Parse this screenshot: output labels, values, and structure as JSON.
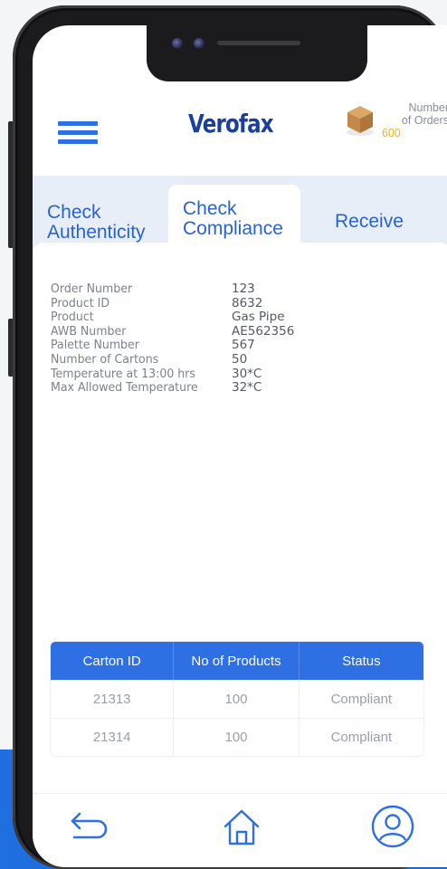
{
  "colors": {
    "accent": "#2f6fe4",
    "order_count": "#e9b42a",
    "brand": "#1d3a8a"
  },
  "header": {
    "logo_text": "Verofax",
    "menu_icon": "hamburger-icon",
    "orders_label_1": "Number",
    "orders_label_2": "of Orders",
    "orders_count": "600"
  },
  "tabs": [
    {
      "line1": "Check",
      "line2": "Authenticity",
      "active": false
    },
    {
      "line1": "Check",
      "line2": "Compliance",
      "active": true
    },
    {
      "line1": "Receive",
      "line2": "",
      "active": false
    }
  ],
  "details": [
    {
      "label": "Order Number",
      "value": "123"
    },
    {
      "label": "Product ID",
      "value": "8632"
    },
    {
      "label": "Product",
      "value": "Gas Pipe"
    },
    {
      "label": "AWB Number",
      "value": "AE562356"
    },
    {
      "label": "Palette Number",
      "value": "567"
    },
    {
      "label": "Number of Cartons",
      "value": "50"
    },
    {
      "label": "Temperature at 13:00 hrs",
      "value": "30*C"
    },
    {
      "label": "Max Allowed Temperature",
      "value": "32*C"
    }
  ],
  "table": {
    "headers": [
      "Carton ID",
      "No of Products",
      "Status"
    ],
    "rows": [
      [
        "21313",
        "100",
        "Compliant"
      ],
      [
        "21314",
        "100",
        "Compliant"
      ]
    ]
  },
  "footer": {
    "back_icon": "back-arrow-icon",
    "home_icon": "home-icon",
    "profile_icon": "user-profile-icon"
  }
}
